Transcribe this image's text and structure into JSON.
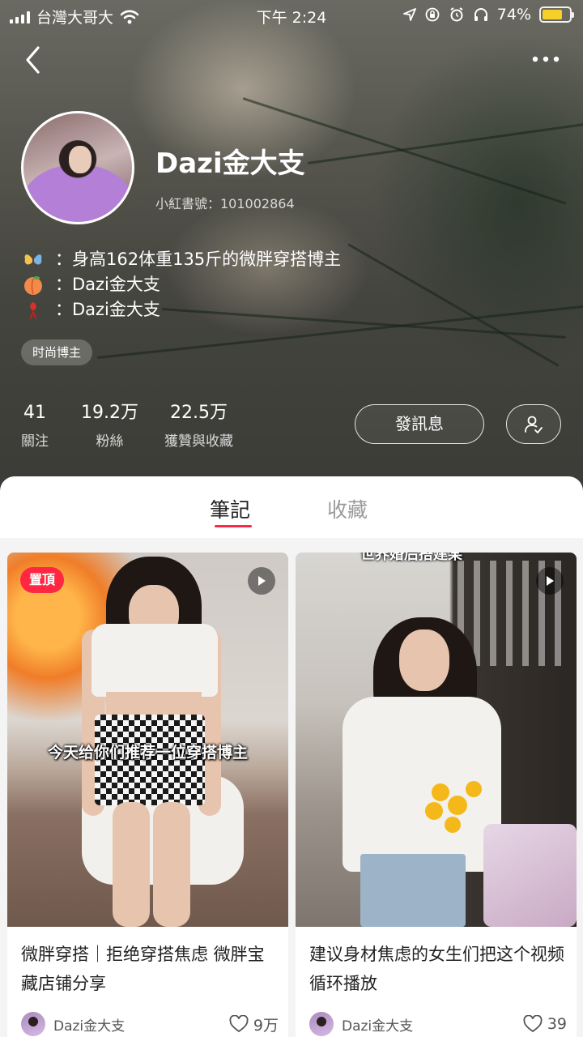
{
  "status_bar": {
    "carrier": "台灣大哥大",
    "time": "下午 2:24",
    "battery": "74%",
    "battery_level": 0.74,
    "icons": [
      "signal-icon",
      "wifi-icon",
      "location-icon",
      "rotation-lock-icon",
      "alarm-icon",
      "headphones-icon",
      "battery-icon"
    ]
  },
  "nav": {
    "back_icon": "chevron-left-icon",
    "more_icon": "more-dots-icon"
  },
  "profile": {
    "name": "Dazi金大支",
    "id_line": "小紅書號：101002864",
    "bio": [
      {
        "emoji": "butterfly-emoji",
        "text": "：身高162体重135斤的微胖穿搭博主"
      },
      {
        "emoji": "peach-emoji",
        "text": "：Dazi金大支"
      },
      {
        "emoji": "red-ribbon-emoji",
        "text": "：Dazi金大支"
      }
    ],
    "tag": "时尚博主",
    "stats": [
      {
        "value": "41",
        "label": "關注"
      },
      {
        "value": "19.2万",
        "label": "粉絲"
      },
      {
        "value": "22.5万",
        "label": "獲贊與收藏"
      }
    ],
    "message_button": "發訊息",
    "follow_icon": "user-check-icon"
  },
  "tabs": {
    "notes": "筆記",
    "collections": "收藏",
    "active": "notes"
  },
  "colors": {
    "accent": "#ff2741",
    "battery": "#f7cf2a"
  },
  "posts": [
    {
      "badge": "置頂",
      "overlay_text": "今天给你们推荐一位穿搭博主",
      "title": "微胖穿搭｜拒绝穿搭焦虑 微胖宝藏店铺分享",
      "author": "Dazi金大支",
      "likes": "9万",
      "is_video": true
    },
    {
      "overlay_text": "世界婚后搭建某",
      "title": "建议身材焦虑的女生们把这个视频循环播放",
      "author": "Dazi金大支",
      "likes": "39",
      "is_video": true
    }
  ]
}
